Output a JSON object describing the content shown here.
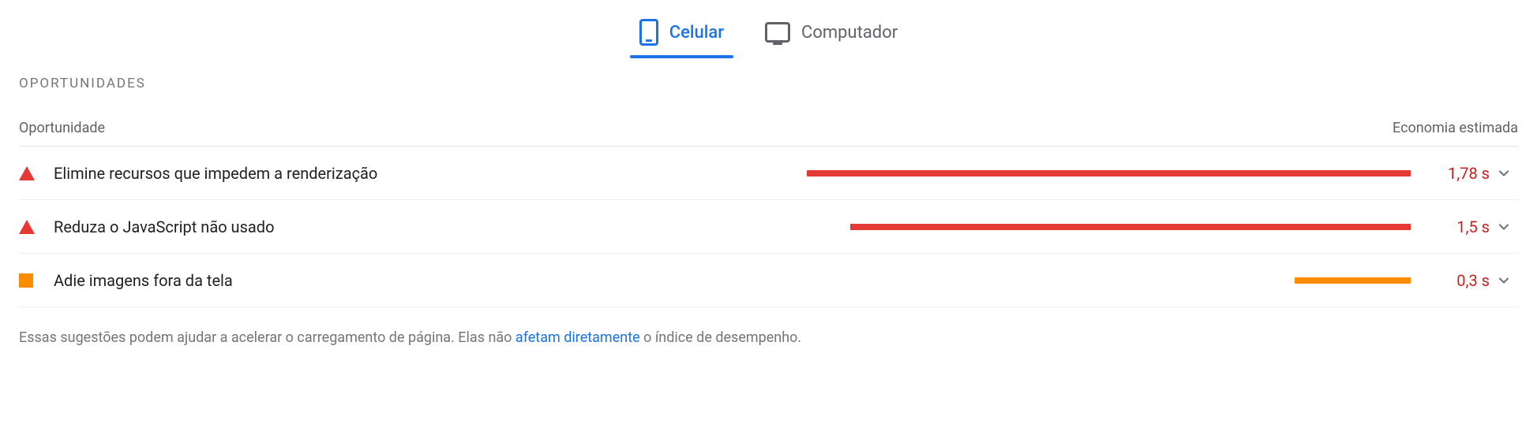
{
  "tabs": {
    "mobile": "Celular",
    "desktop": "Computador",
    "active": "mobile"
  },
  "section": {
    "heading": "OPORTUNIDADES",
    "col_opportunity": "Oportunidade",
    "col_savings": "Economia estimada"
  },
  "bar_max_seconds": 3.0,
  "rows": [
    {
      "status": "triangle",
      "title": "Elimine recursos que impedem a renderização",
      "seconds": 1.78,
      "savings": "1,78 s",
      "bar_color": "#e53935"
    },
    {
      "status": "triangle",
      "title": "Reduza o JavaScript não usado",
      "seconds": 1.5,
      "savings": "1,5 s",
      "bar_color": "#e53935"
    },
    {
      "status": "square",
      "title": "Adie imagens fora da tela",
      "seconds": 0.3,
      "savings": "0,3 s",
      "bar_color": "#fb8c00"
    }
  ],
  "footnote": {
    "pre": "Essas sugestões podem ajudar a acelerar o carregamento de página. Elas não ",
    "link": "afetam diretamente",
    "post": " o índice de desempenho."
  }
}
